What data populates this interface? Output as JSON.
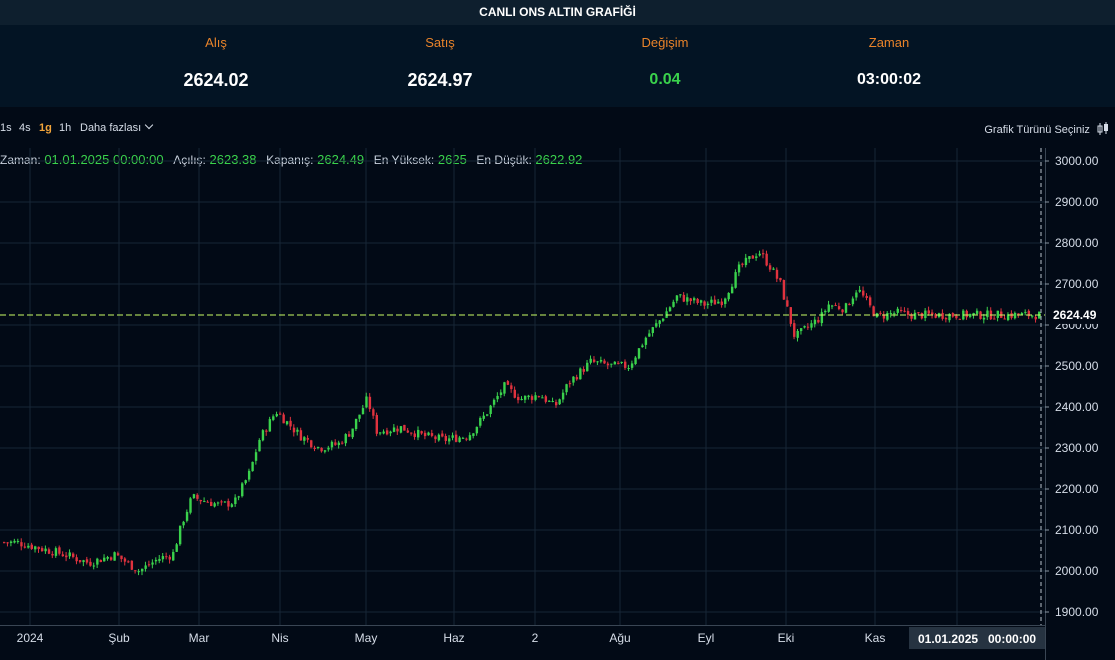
{
  "header": {
    "title": "CANLI ONS ALTIN GRAFİĞİ"
  },
  "quotes": {
    "bid": {
      "label": "Alış",
      "value": "2624.02"
    },
    "ask": {
      "label": "Satış",
      "value": "2624.97"
    },
    "change": {
      "label": "Değişim",
      "value": "0.04"
    },
    "time": {
      "label": "Zaman",
      "value": "03:00:02"
    }
  },
  "toolbar": {
    "timeframes": [
      "1s",
      "4s",
      "1g",
      "1h"
    ],
    "active_timeframe": "1g",
    "more_label": "Daha fazlası",
    "chart_type_label": "Grafik Türünü Seçiniz"
  },
  "ohlc": {
    "time_label": "Zaman:",
    "time_value": "01.01.2025 00:00:00",
    "open_label": "Açılış:",
    "open_value": "2623.38",
    "close_label": "Kapanış:",
    "close_value": "2624.49",
    "high_label": "En Yüksek:",
    "high_value": "2625",
    "low_label": "En Düşük:",
    "low_value": "2622.92"
  },
  "colors": {
    "up": "#3ad24c",
    "down": "#e0323e",
    "accent": "#e8832a",
    "grid": "#172636",
    "background": "#020a16",
    "crosshair": "#c9ff66"
  },
  "chart_data": {
    "type": "candlestick",
    "title": "",
    "x_labels": [
      "2024",
      "Şub",
      "Mar",
      "Nis",
      "May",
      "Haz",
      "2",
      "Ağu",
      "Eyl",
      "Eki",
      "Kas"
    ],
    "y_ticks": [
      "3000.00",
      "2900.00",
      "2800.00",
      "2700.00",
      "2600.00",
      "2500.00",
      "2400.00",
      "2300.00",
      "2200.00",
      "2100.00",
      "2000.00",
      "1900.00"
    ],
    "y_range": [
      1870,
      3020
    ],
    "last_price": "2624.49",
    "crosshair_date": "01.01.2025",
    "crosshair_time": "00:00:00",
    "grid": true,
    "close_path": [
      [
        "2023-12-26",
        2070
      ],
      [
        "2024-01-02",
        2060
      ],
      [
        "2024-01-15",
        2040
      ],
      [
        "2024-01-25",
        2020
      ],
      [
        "2024-02-05",
        2040
      ],
      [
        "2024-02-15",
        2000
      ],
      [
        "2024-02-23",
        2030
      ],
      [
        "2024-02-29",
        2040
      ],
      [
        "2024-03-04",
        2120
      ],
      [
        "2024-03-08",
        2180
      ],
      [
        "2024-03-20",
        2160
      ],
      [
        "2024-03-26",
        2170
      ],
      [
        "2024-04-01",
        2240
      ],
      [
        "2024-04-05",
        2320
      ],
      [
        "2024-04-12",
        2390
      ],
      [
        "2024-04-22",
        2330
      ],
      [
        "2024-04-30",
        2300
      ],
      [
        "2024-05-08",
        2310
      ],
      [
        "2024-05-13",
        2340
      ],
      [
        "2024-05-20",
        2420
      ],
      [
        "2024-05-24",
        2340
      ],
      [
        "2024-06-03",
        2350
      ],
      [
        "2024-06-12",
        2330
      ],
      [
        "2024-06-21",
        2320
      ],
      [
        "2024-07-01",
        2330
      ],
      [
        "2024-07-08",
        2380
      ],
      [
        "2024-07-16",
        2450
      ],
      [
        "2024-07-23",
        2420
      ],
      [
        "2024-07-31",
        2430
      ],
      [
        "2024-08-06",
        2400
      ],
      [
        "2024-08-12",
        2460
      ],
      [
        "2024-08-21",
        2510
      ],
      [
        "2024-08-30",
        2500
      ],
      [
        "2024-09-06",
        2500
      ],
      [
        "2024-09-13",
        2570
      ],
      [
        "2024-09-20",
        2620
      ],
      [
        "2024-09-26",
        2670
      ],
      [
        "2024-10-07",
        2650
      ],
      [
        "2024-10-15",
        2660
      ],
      [
        "2024-10-22",
        2740
      ],
      [
        "2024-10-30",
        2780
      ],
      [
        "2024-11-04",
        2740
      ],
      [
        "2024-11-08",
        2700
      ],
      [
        "2024-11-14",
        2570
      ],
      [
        "2024-11-25",
        2620
      ],
      [
        "2024-11-28",
        2650
      ],
      [
        "2024-12-05",
        2640
      ],
      [
        "2024-12-10",
        2690
      ],
      [
        "2024-12-18",
        2620
      ],
      [
        "2024-12-26",
        2630
      ],
      [
        "2025-01-01",
        2624.49
      ]
    ]
  }
}
